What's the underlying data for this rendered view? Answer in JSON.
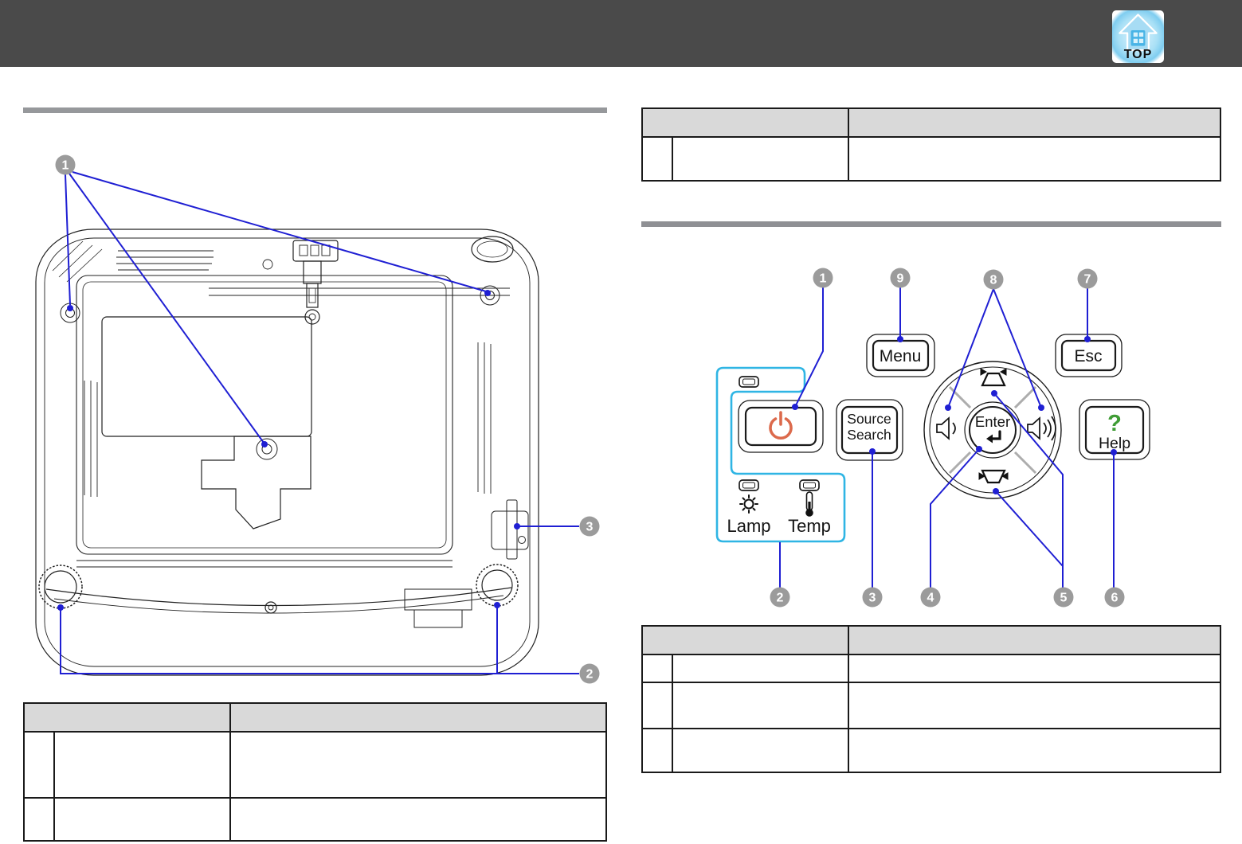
{
  "topbar": {
    "top_link_label": "TOP"
  },
  "left_section": {
    "diagram_callouts": {
      "c1": "1",
      "c2": "2",
      "c3": "3"
    },
    "table": {
      "header": [
        "",
        ""
      ],
      "rows": [
        [
          "",
          "",
          ""
        ],
        [
          "",
          "",
          ""
        ]
      ]
    }
  },
  "right_section": {
    "top_table": {
      "header": [
        "",
        ""
      ],
      "rows": [
        [
          "",
          "",
          ""
        ]
      ]
    },
    "bottom_table": {
      "header": [
        "",
        ""
      ],
      "rows": [
        [
          "",
          "",
          ""
        ],
        [
          "",
          "",
          ""
        ],
        [
          "",
          "",
          ""
        ]
      ]
    },
    "panel": {
      "callouts": {
        "c1": "1",
        "c2": "2",
        "c3": "3",
        "c4": "4",
        "c5": "5",
        "c6": "6",
        "c7": "7",
        "c8": "8",
        "c9": "9"
      },
      "menu_label": "Menu",
      "esc_label": "Esc",
      "source_label_line1": "Source",
      "source_label_line2": "Search",
      "enter_label": "Enter",
      "help_mark": "?",
      "help_label": "Help",
      "lamp_label": "Lamp",
      "temp_label": "Temp"
    }
  },
  "colors": {
    "topbar_bg": "#4a4a4a",
    "callout_line_blue": "#1f1fd3",
    "panel_highlight_cyan": "#2fb5e4",
    "power_icon_orange": "#dc6a4c",
    "help_mark_green": "#3f9c35",
    "callout_circle_gray": "#9b9b9b",
    "table_header_gray": "#d9d9d9",
    "section_rule_gray": "#96989b"
  }
}
